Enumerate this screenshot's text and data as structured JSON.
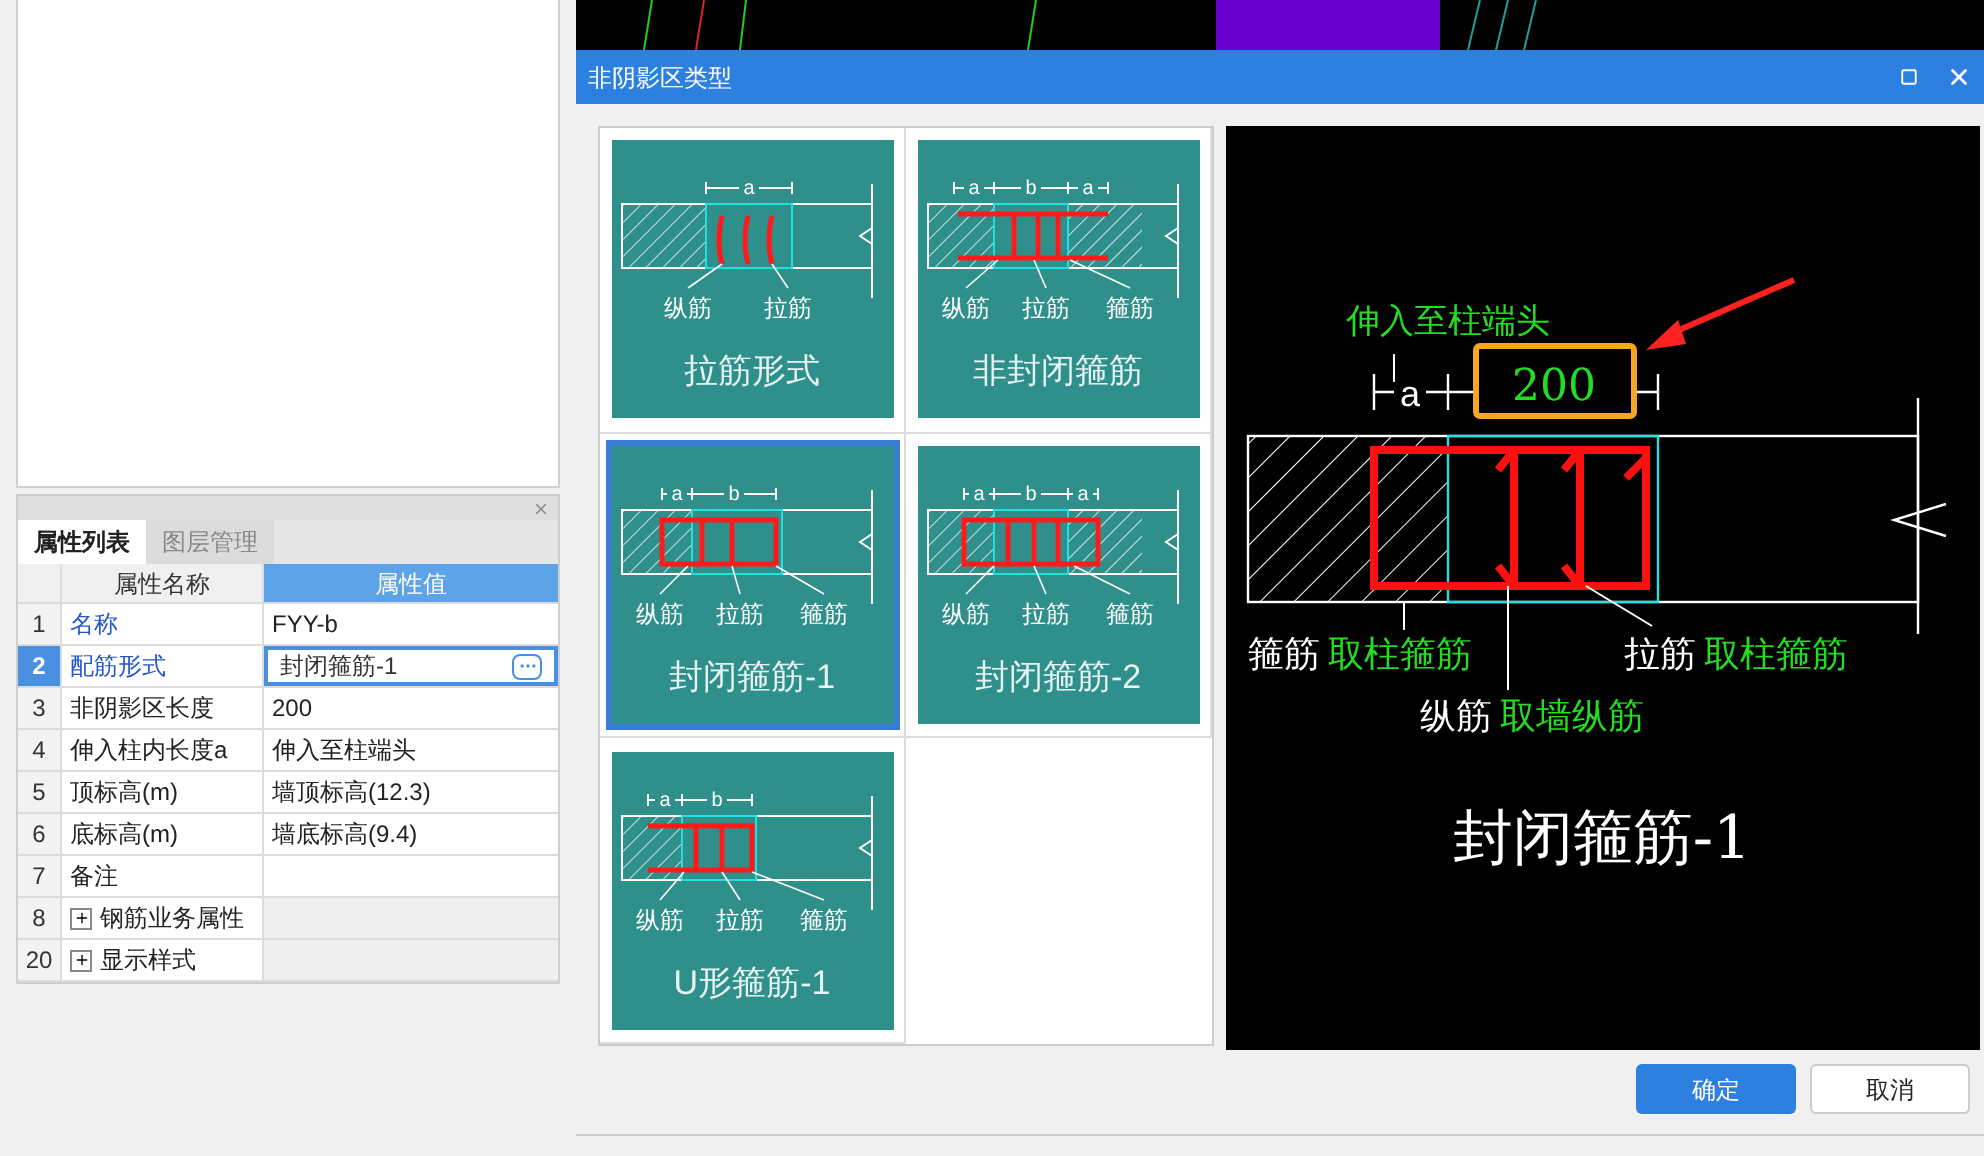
{
  "property_panel": {
    "tabs": [
      {
        "label": "属性列表",
        "selected": true
      },
      {
        "label": "图层管理",
        "selected": false
      }
    ],
    "columns": [
      "属性名称",
      "属性值"
    ],
    "rows": [
      {
        "index": "1",
        "name": "名称",
        "value": "FYY-b",
        "kind": "field",
        "required": true,
        "selected": false
      },
      {
        "index": "2",
        "name": "配筋形式",
        "value": "封闭箍筋-1",
        "kind": "field",
        "required": true,
        "selected": true
      },
      {
        "index": "3",
        "name": "非阴影区长度",
        "value": "200",
        "kind": "field",
        "required": false,
        "selected": false
      },
      {
        "index": "4",
        "name": "伸入柱内长度a",
        "value": "伸入至柱端头",
        "kind": "field",
        "required": false,
        "selected": false
      },
      {
        "index": "5",
        "name": "顶标高(m)",
        "value": "墙顶标高(12.3)",
        "kind": "field",
        "required": false,
        "selected": false
      },
      {
        "index": "6",
        "name": "底标高(m)",
        "value": "墙底标高(9.4)",
        "kind": "field",
        "required": false,
        "selected": false
      },
      {
        "index": "7",
        "name": "备注",
        "kind": "field",
        "required": false,
        "selected": false
      },
      {
        "index": "8",
        "name": "钢筋业务属性",
        "kind": "group",
        "expanded": false,
        "selected": false
      },
      {
        "index": "20",
        "name": "显示样式",
        "kind": "group",
        "expanded": false,
        "selected": false
      }
    ]
  },
  "dialog": {
    "title": "非阴影区类型",
    "options": [
      {
        "label": "拉筋形式",
        "kind": "ties",
        "dims": [
          "a"
        ],
        "callouts": [
          "纵筋",
          "拉筋"
        ],
        "selected": false
      },
      {
        "label": "非封闭箍筋",
        "kind": "open",
        "dims": [
          "a",
          "b",
          "a"
        ],
        "callouts": [
          "纵筋",
          "拉筋",
          "箍筋"
        ],
        "selected": false
      },
      {
        "label": "封闭箍筋-1",
        "kind": "closed1",
        "dims": [
          "a",
          "b"
        ],
        "callouts": [
          "纵筋",
          "拉筋",
          "箍筋"
        ],
        "selected": true
      },
      {
        "label": "封闭箍筋-2",
        "kind": "closed2",
        "dims": [
          "a",
          "b",
          "a"
        ],
        "callouts": [
          "纵筋",
          "拉筋",
          "箍筋"
        ],
        "selected": false
      },
      {
        "label": "U形箍筋-1",
        "kind": "u",
        "dims": [
          "a",
          "b"
        ],
        "callouts": [
          "纵筋",
          "拉筋",
          "箍筋"
        ],
        "selected": false
      }
    ],
    "preview": {
      "length_note": "伸入至柱端头",
      "dims": [
        "a",
        "200"
      ],
      "callouts": [
        {
          "rebar": "箍筋",
          "source": "取柱箍筋"
        },
        {
          "rebar": "拉筋",
          "source": "取柱箍筋"
        },
        {
          "rebar": "纵筋",
          "source": "取墙纵筋"
        }
      ],
      "title": "封闭箍筋-1"
    },
    "buttons": [
      {
        "label": "确定",
        "kind": "primary"
      },
      {
        "label": "取消",
        "kind": "secondary"
      }
    ]
  }
}
